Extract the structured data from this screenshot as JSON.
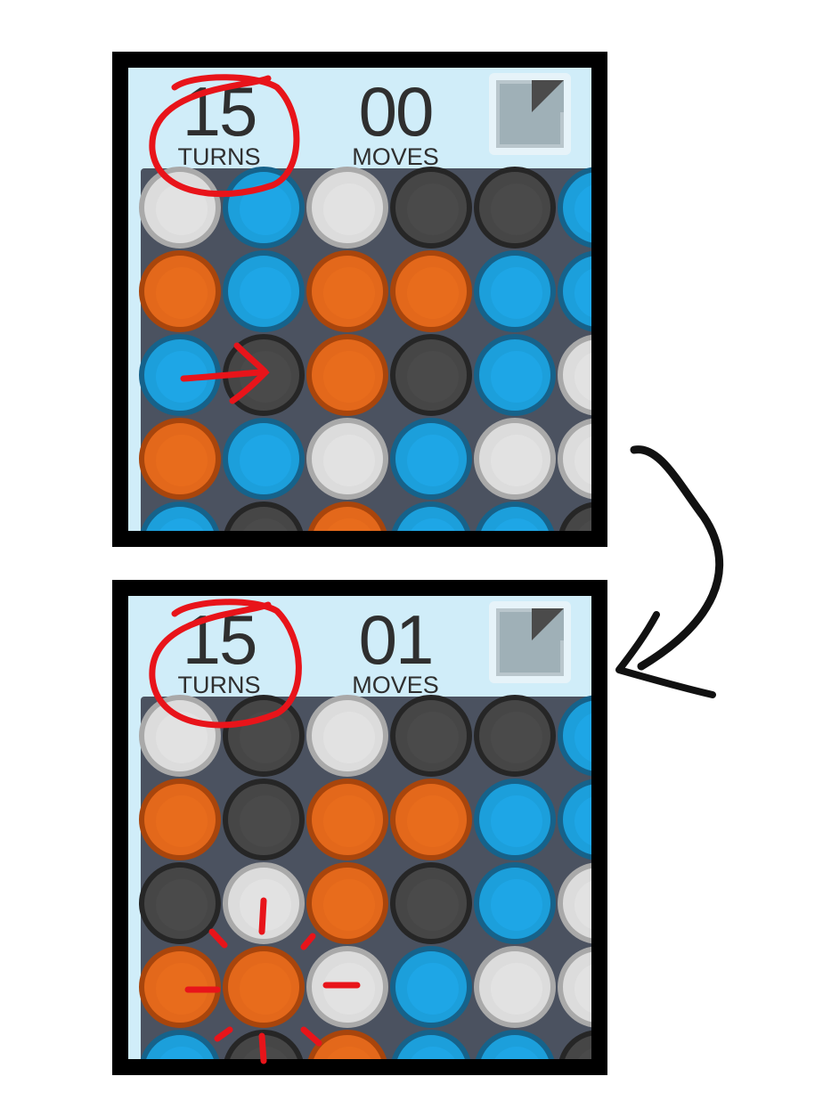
{
  "before": {
    "turns": {
      "value": "15",
      "label": "TURNS"
    },
    "moves": {
      "value": "00",
      "label": "MOVES"
    }
  },
  "after": {
    "turns": {
      "value": "15",
      "label": "TURNS"
    },
    "moves": {
      "value": "01",
      "label": "MOVES"
    }
  },
  "icons": {
    "menu": "menu-corner-icon",
    "transition": "curved-arrow-icon",
    "swap": "arrow-right-icon",
    "burst": "burst-icon"
  },
  "colors": {
    "white": "#dcdcdc",
    "blue": "#1ea6e6",
    "orange": "#e86c1c",
    "dark": "#4a4a4a",
    "annotation": "#e8141a"
  },
  "board_before": [
    [
      "white",
      "blue",
      "white",
      "dark",
      "dark",
      "blue"
    ],
    [
      "orange",
      "blue",
      "orange",
      "orange",
      "blue",
      "blue"
    ],
    [
      "blue",
      "dark",
      "orange",
      "dark",
      "blue",
      "white"
    ],
    [
      "orange",
      "blue",
      "white",
      "blue",
      "white",
      "white"
    ],
    [
      "blue",
      "dark",
      "orange",
      "blue",
      "blue",
      "dark"
    ]
  ],
  "board_after": [
    [
      "white",
      "dark",
      "white",
      "dark",
      "dark",
      "blue"
    ],
    [
      "orange",
      "dark",
      "orange",
      "orange",
      "blue",
      "blue"
    ],
    [
      "dark",
      "white",
      "orange",
      "dark",
      "blue",
      "white"
    ],
    [
      "orange",
      "orange",
      "white",
      "blue",
      "white",
      "white"
    ],
    [
      "blue",
      "dark",
      "orange",
      "blue",
      "blue",
      "dark"
    ]
  ]
}
